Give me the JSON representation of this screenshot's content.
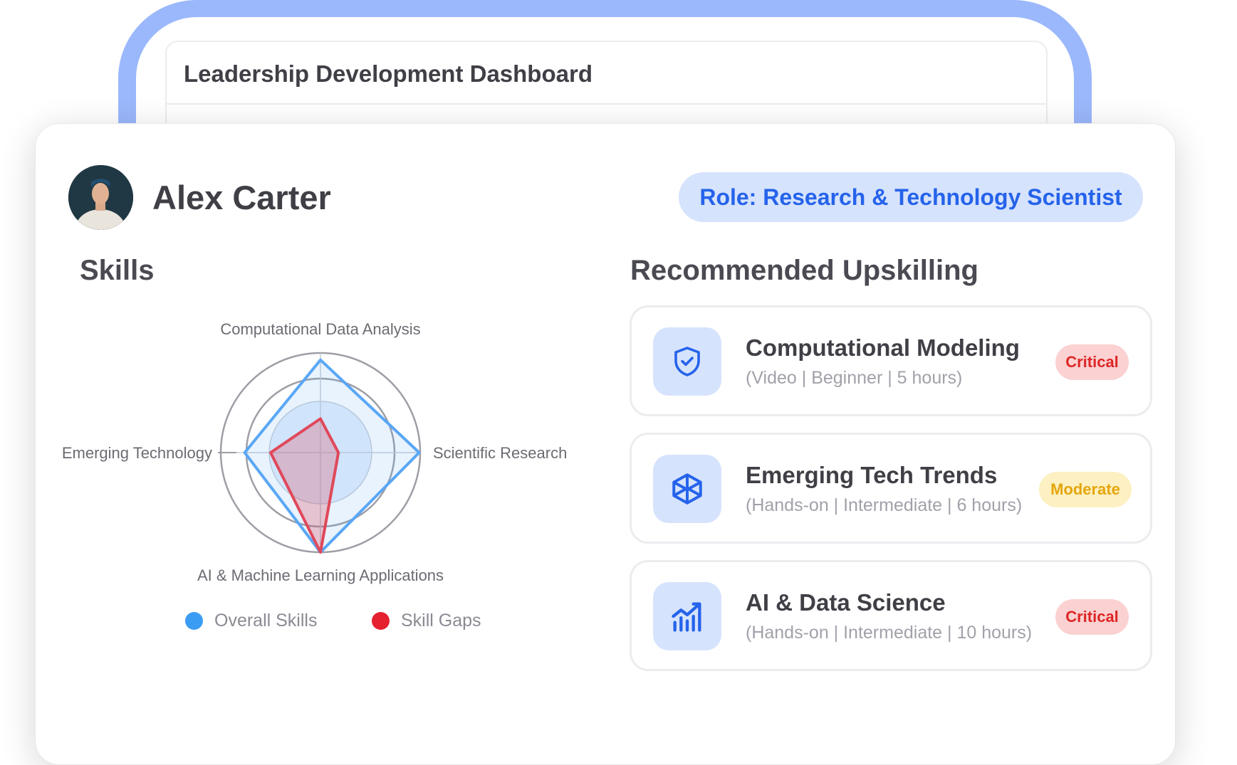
{
  "dashboard": {
    "title": "Leadership Development Dashboard"
  },
  "profile": {
    "name": "Alex Carter",
    "role": "Role: Research & Technology Scientist"
  },
  "skills": {
    "section_title": "Skills",
    "chart_data": {
      "type": "radar",
      "axes": [
        "Computational Data Analysis",
        "Scientific Research",
        "AI & Machine Learning Applications",
        "Emerging Technology"
      ],
      "series": [
        {
          "name": "Overall Skills",
          "color": "#5aa7f5",
          "values": [
            0.93,
            0.99,
            1.0,
            0.76
          ]
        },
        {
          "name": "Skill Gaps",
          "color": "#e0485a",
          "values": [
            0.34,
            0.18,
            1.0,
            0.5
          ]
        }
      ]
    },
    "legend": [
      {
        "label": "Overall Skills",
        "color": "#3b9cf3"
      },
      {
        "label": "Skill Gaps",
        "color": "#e5202f"
      }
    ]
  },
  "upskilling": {
    "section_title": "Recommended Upskilling",
    "courses": [
      {
        "title": "Computational Modeling",
        "meta": "(Video | Beginner | 5 hours)",
        "badge": "Critical",
        "icon": "shield-check-icon"
      },
      {
        "title": "Emerging Tech Trends",
        "meta": "(Hands-on | Intermediate | 6 hours)",
        "badge": "Moderate",
        "icon": "cube-icon"
      },
      {
        "title": "AI & Data Science",
        "meta": "(Hands-on | Intermediate | 10 hours)",
        "badge": "Critical",
        "icon": "chart-trend-icon"
      }
    ]
  },
  "colors": {
    "accent": "#2563eb",
    "frame": "#9bb8fc",
    "icon_bg": "#d6e3fd",
    "critical_bg": "#fbd1d1",
    "critical_text": "#dc2626",
    "moderate_bg": "#fdf0c2",
    "moderate_text": "#e5a60c"
  }
}
